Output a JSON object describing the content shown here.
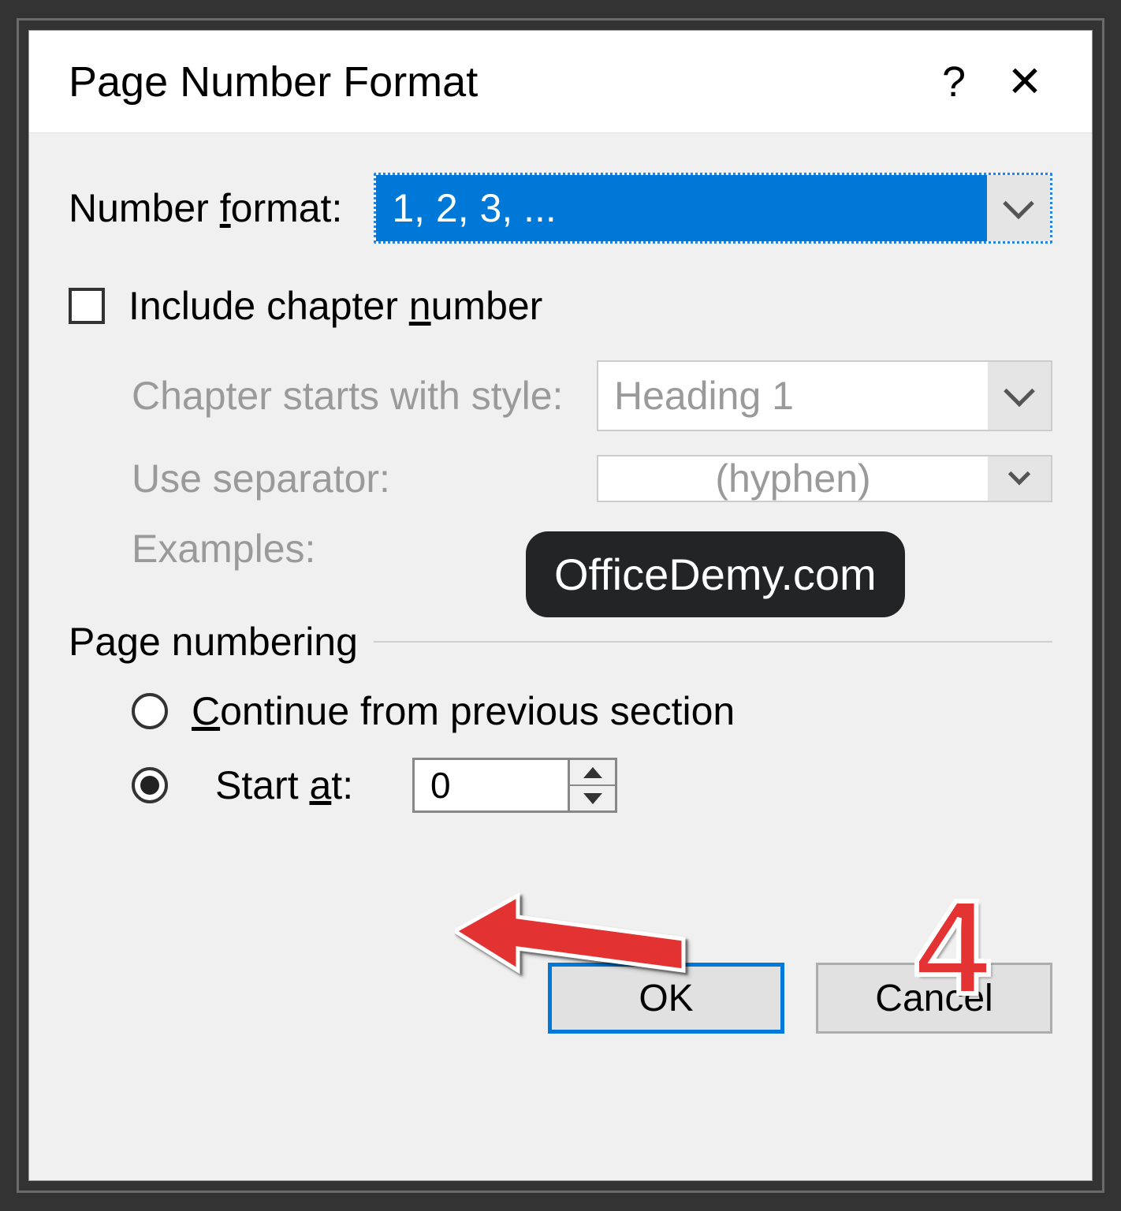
{
  "title": "Page Number Format",
  "titlebar": {
    "help": "?",
    "close": "✕"
  },
  "number_format": {
    "label_pre": "Number ",
    "label_u": "f",
    "label_post": "ormat:",
    "value": "1, 2, 3, ..."
  },
  "include_chapter": {
    "label_pre": "Include chapter ",
    "label_u": "n",
    "label_post": "umber",
    "checked": false
  },
  "chapter_style": {
    "label": "Chapter starts with style:",
    "value": "Heading 1"
  },
  "separator": {
    "label": "Use separator:",
    "value": "(hyphen)"
  },
  "examples": {
    "label": "Examples:"
  },
  "page_numbering": {
    "title": "Page numbering",
    "continue": {
      "pre": "",
      "u": "C",
      "post": "ontinue from previous section"
    },
    "start_at": {
      "pre": "Start ",
      "u": "a",
      "post": "t:",
      "value": "0"
    }
  },
  "buttons": {
    "ok": "OK",
    "cancel": "Cancel"
  },
  "watermark": "OfficeDemy.com",
  "annotation": "4"
}
